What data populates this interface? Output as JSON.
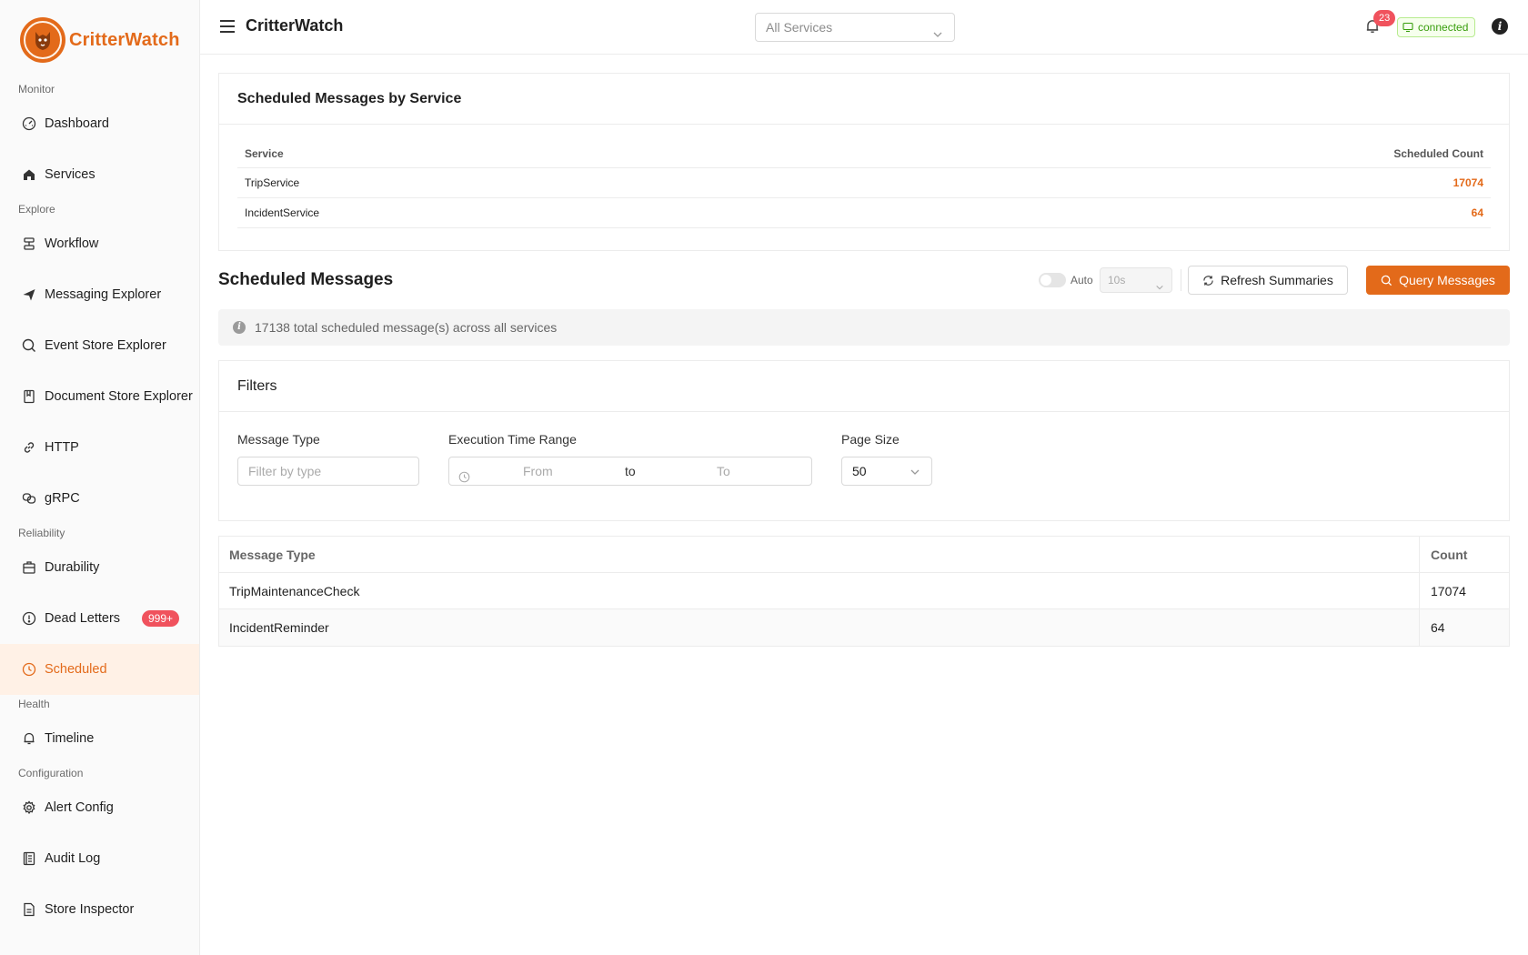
{
  "app": {
    "name": "CritterWatch",
    "header_title": "CritterWatch"
  },
  "header": {
    "service_select": "All Services",
    "notification_count": "23",
    "connection_status": "connected"
  },
  "sidebar": {
    "sections": [
      {
        "title": "Monitor",
        "items": [
          {
            "label": "Dashboard",
            "icon": "dashboard-icon"
          },
          {
            "label": "Services",
            "icon": "home-icon"
          }
        ]
      },
      {
        "title": "Explore",
        "items": [
          {
            "label": "Workflow",
            "icon": "workflow-icon"
          },
          {
            "label": "Messaging Explorer",
            "icon": "send-icon"
          },
          {
            "label": "Event Store Explorer",
            "icon": "search-icon"
          },
          {
            "label": "Document Store Explorer",
            "icon": "book-icon"
          },
          {
            "label": "HTTP",
            "icon": "link-icon"
          },
          {
            "label": "gRPC",
            "icon": "grpc-icon"
          }
        ]
      },
      {
        "title": "Reliability",
        "items": [
          {
            "label": "Durability",
            "icon": "briefcase-icon"
          },
          {
            "label": "Dead Letters",
            "icon": "exclamation-icon",
            "badge": "999+"
          },
          {
            "label": "Scheduled",
            "icon": "clock-icon",
            "active": true
          }
        ]
      },
      {
        "title": "Health",
        "items": [
          {
            "label": "Timeline",
            "icon": "bell-icon"
          }
        ]
      },
      {
        "title": "Configuration",
        "items": [
          {
            "label": "Alert Config",
            "icon": "gear-icon"
          },
          {
            "label": "Audit Log",
            "icon": "log-icon"
          },
          {
            "label": "Store Inspector",
            "icon": "file-icon"
          }
        ]
      }
    ]
  },
  "summary": {
    "title": "Scheduled Messages by Service",
    "columns": [
      "Service",
      "Scheduled Count"
    ],
    "rows": [
      [
        "TripService",
        "17074"
      ],
      [
        "IncidentService",
        "64"
      ]
    ]
  },
  "scheduled": {
    "title": "Scheduled Messages",
    "auto_label": "Auto",
    "interval": "10s",
    "refresh_label": "Refresh Summaries",
    "query_label": "Query Messages",
    "info_text": "17138 total scheduled message(s) across all services"
  },
  "filters": {
    "title": "Filters",
    "message_type_label": "Message Type",
    "message_type_placeholder": "Filter by type",
    "time_range_label": "Execution Time Range",
    "from_placeholder": "From",
    "separator": "to",
    "to_placeholder": "To",
    "page_size_label": "Page Size",
    "page_size": "50"
  },
  "messages": {
    "columns": [
      "Message Type",
      "Count"
    ],
    "rows": [
      [
        "TripMaintenanceCheck",
        "17074"
      ],
      [
        "IncidentReminder",
        "64"
      ]
    ]
  }
}
